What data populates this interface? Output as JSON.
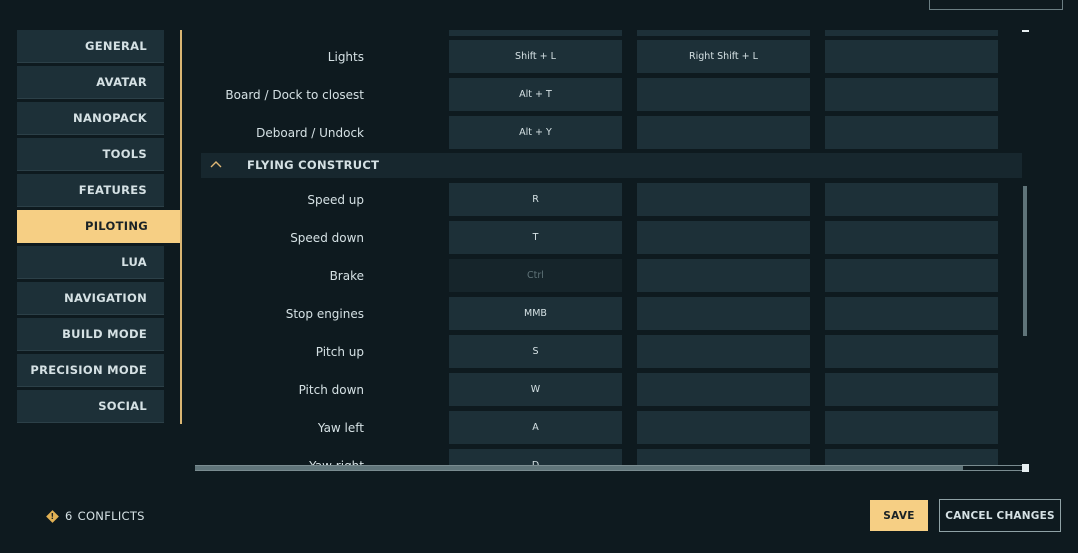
{
  "sidebar": {
    "items": [
      {
        "label": "GENERAL"
      },
      {
        "label": "AVATAR"
      },
      {
        "label": "NANOPACK"
      },
      {
        "label": "TOOLS"
      },
      {
        "label": "FEATURES"
      },
      {
        "label": "PILOTING",
        "active": true
      },
      {
        "label": "LUA"
      },
      {
        "label": "NAVIGATION"
      },
      {
        "label": "BUILD MODE"
      },
      {
        "label": "PRECISION MODE"
      },
      {
        "label": "SOCIAL"
      }
    ]
  },
  "bindings": {
    "rows_before": [
      {
        "action": "Lights",
        "keys": [
          "Shift + L",
          "Right Shift + L",
          ""
        ]
      },
      {
        "action": "Board / Dock to closest",
        "keys": [
          "Alt + T",
          "",
          ""
        ]
      },
      {
        "action": "Deboard / Undock",
        "keys": [
          "Alt + Y",
          "",
          ""
        ]
      }
    ],
    "section": {
      "title": "FLYING CONSTRUCT",
      "icon": "chevron-up-icon"
    },
    "rows_after": [
      {
        "action": "Speed up",
        "keys": [
          "R",
          "",
          ""
        ]
      },
      {
        "action": "Speed down",
        "keys": [
          "T",
          "",
          ""
        ]
      },
      {
        "action": "Brake",
        "keys": [
          "Ctrl",
          "",
          ""
        ],
        "disabled": true
      },
      {
        "action": "Stop engines",
        "keys": [
          "MMB",
          "",
          ""
        ]
      },
      {
        "action": "Pitch up",
        "keys": [
          "S",
          "",
          ""
        ]
      },
      {
        "action": "Pitch down",
        "keys": [
          "W",
          "",
          ""
        ]
      },
      {
        "action": "Yaw left",
        "keys": [
          "A",
          "",
          ""
        ]
      },
      {
        "action": "Yaw right",
        "keys": [
          "D",
          "",
          ""
        ]
      }
    ]
  },
  "footer": {
    "conflict_count": "6",
    "conflict_label": "CONFLICTS",
    "warning_icon": "warning-icon",
    "save_label": "SAVE",
    "cancel_label": "CANCEL CHANGES"
  },
  "colors": {
    "accent": "#f6cf84",
    "panel": "#1d3038",
    "background": "#0e1a1f",
    "warning": "#e1b154"
  }
}
